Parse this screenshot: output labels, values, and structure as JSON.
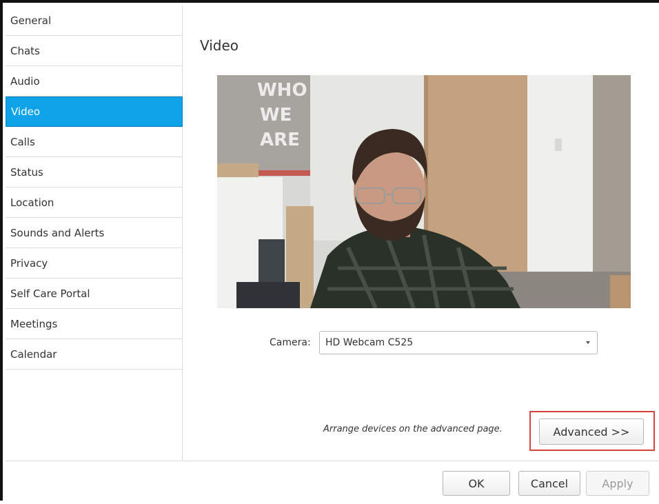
{
  "sidebar": {
    "items": [
      {
        "label": "General"
      },
      {
        "label": "Chats"
      },
      {
        "label": "Audio"
      },
      {
        "label": "Video"
      },
      {
        "label": "Calls"
      },
      {
        "label": "Status"
      },
      {
        "label": "Location"
      },
      {
        "label": "Sounds and Alerts"
      },
      {
        "label": "Privacy"
      },
      {
        "label": "Self Care Portal"
      },
      {
        "label": "Meetings"
      },
      {
        "label": "Calendar"
      }
    ],
    "selected": "Video",
    "accent_color": "#0ea3e8"
  },
  "main": {
    "title": "Video",
    "camera_label": "Camera:",
    "camera_value": "HD Webcam C525",
    "advanced_hint": "Arrange devices on the advanced page.",
    "advanced_button": "Advanced >>",
    "preview_sign_text": [
      "WHO",
      "WE",
      "ARE"
    ],
    "highlight_color": "#d6423f"
  },
  "footer": {
    "ok": "OK",
    "cancel": "Cancel",
    "apply": "Apply"
  }
}
